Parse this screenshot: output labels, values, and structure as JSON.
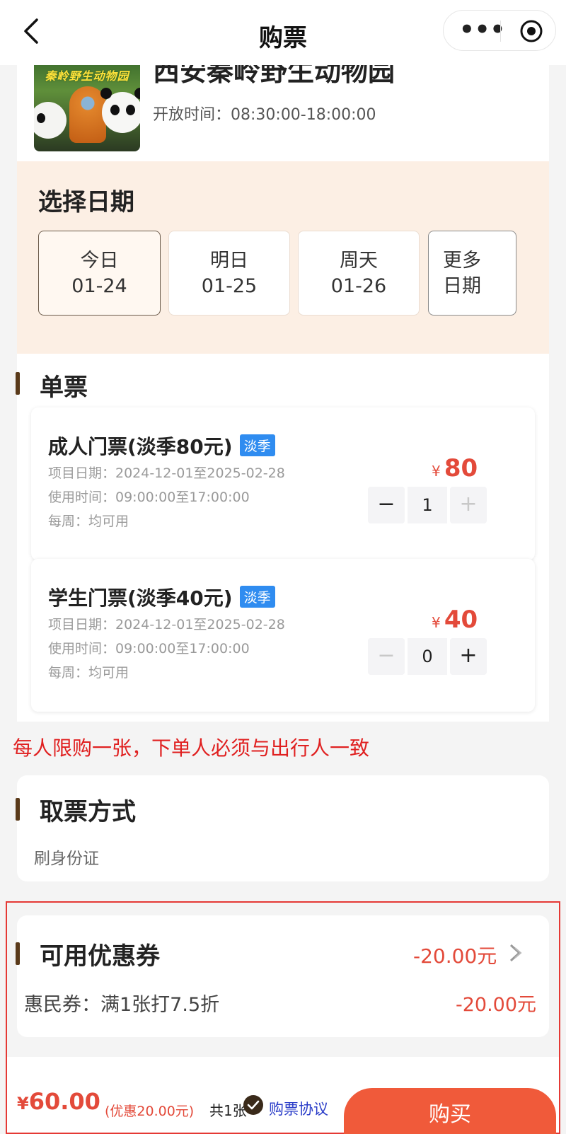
{
  "nav": {
    "title": "购票",
    "more_label": "•••"
  },
  "park": {
    "name": "西安秦岭野生动物园",
    "thumb_sign": "秦岭野生动物园",
    "open_time": "开放时间：08:30:00-18:00:00"
  },
  "date_section": {
    "title": "选择日期",
    "options": [
      {
        "line1": "今日",
        "line2": "01-24",
        "selected": true
      },
      {
        "line1": "明日",
        "line2": "01-25",
        "selected": false
      },
      {
        "line1": "周天",
        "line2": "01-26",
        "selected": false
      },
      {
        "line1": "更多",
        "line2": "日期",
        "selected": false
      }
    ]
  },
  "tickets": {
    "title": "单票",
    "items": [
      {
        "name": "成人门票(淡季80元)",
        "badge": "淡季",
        "date_range": "项目日期：2024-12-01至2025-02-28",
        "use_time": "使用时间：09:00:00至17:00:00",
        "weekly": "每周：均可用",
        "currency": "¥",
        "price": "80",
        "quantity": "1",
        "minus_label": "−",
        "plus_label": "+"
      },
      {
        "name": "学生门票(淡季40元)",
        "badge": "淡季",
        "date_range": "项目日期：2024-12-01至2025-02-28",
        "use_time": "使用时间：09:00:00至17:00:00",
        "weekly": "每周：均可用",
        "currency": "¥",
        "price": "40",
        "quantity": "0",
        "minus_label": "−",
        "plus_label": "+"
      }
    ]
  },
  "limit_note": "每人限购一张，下单人必须与出行人一致",
  "pickup": {
    "title": "取票方式",
    "value": "刷身份证"
  },
  "coupon": {
    "title": "可用优惠券",
    "total_discount": "-20.00元",
    "line_label": "惠民券：满1张打7.5折",
    "line_amount": "-20.00元"
  },
  "bottom": {
    "currency": "¥",
    "total": "60.00",
    "discount_note": "(优惠20.00元)",
    "count_note": "共1张",
    "agreement": "购票协议",
    "buy_label": "购买"
  },
  "colors": {
    "accent_red": "#e34a3a",
    "buy_button": "#f05a3a",
    "date_bg": "#fcefe4",
    "badge_blue": "#2f8cf0",
    "section_bar": "#5a3a1a"
  }
}
